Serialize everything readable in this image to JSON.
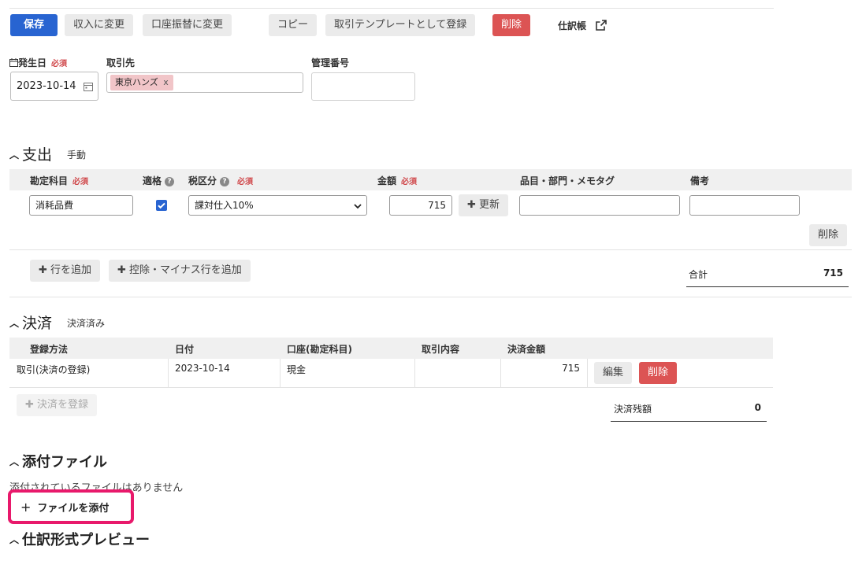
{
  "toolbar": {
    "save": "保存",
    "to_income": "収入に変更",
    "to_transfer": "口座振替に変更",
    "copy": "コピー",
    "register_template": "取引テンプレートとして登録",
    "delete": "削除",
    "journal": "仕訳帳"
  },
  "form": {
    "date_label": "発生日",
    "required": "必須",
    "date_value": "2023-10-14",
    "partner_label": "取引先",
    "partner_tag": "東京ハンズ",
    "partner_tag_remove": "x",
    "mgmt_label": "管理番号",
    "mgmt_value": ""
  },
  "expense": {
    "title": "支出",
    "mode": "手動",
    "headers": {
      "account": "勘定科目",
      "qualified": "適格",
      "tax": "税区分",
      "amount": "金額",
      "items": "品目・部門・メモタグ",
      "note": "備考"
    },
    "row": {
      "account": "消耗品費",
      "qualified_checked": true,
      "tax": "課対仕入10%",
      "amount": "715",
      "update": "更新",
      "items": "",
      "note": "",
      "delete": "削除"
    },
    "add_row": "行を追加",
    "add_deduction_row": "控除・マイナス行を追加",
    "total_label": "合計",
    "total_value": "715"
  },
  "settlement": {
    "title": "決済",
    "status": "決済済み",
    "headers": {
      "method": "登録方法",
      "date": "日付",
      "account": "口座(勘定科目)",
      "details": "取引内容",
      "amount": "決済金額"
    },
    "row": {
      "method": "取引(決済の登録)",
      "date": "2023-10-14",
      "account": "現金",
      "details": "",
      "amount": "715",
      "edit": "編集",
      "delete": "削除"
    },
    "register": "決済を登録",
    "balance_label": "決済残額",
    "balance_value": "0"
  },
  "attachments": {
    "title": "添付ファイル",
    "empty": "添付されているファイルはありません",
    "attach": "ファイルを添付",
    "highlight_color": "#e8196b"
  },
  "preview": {
    "title": "仕訳形式プレビュー"
  }
}
